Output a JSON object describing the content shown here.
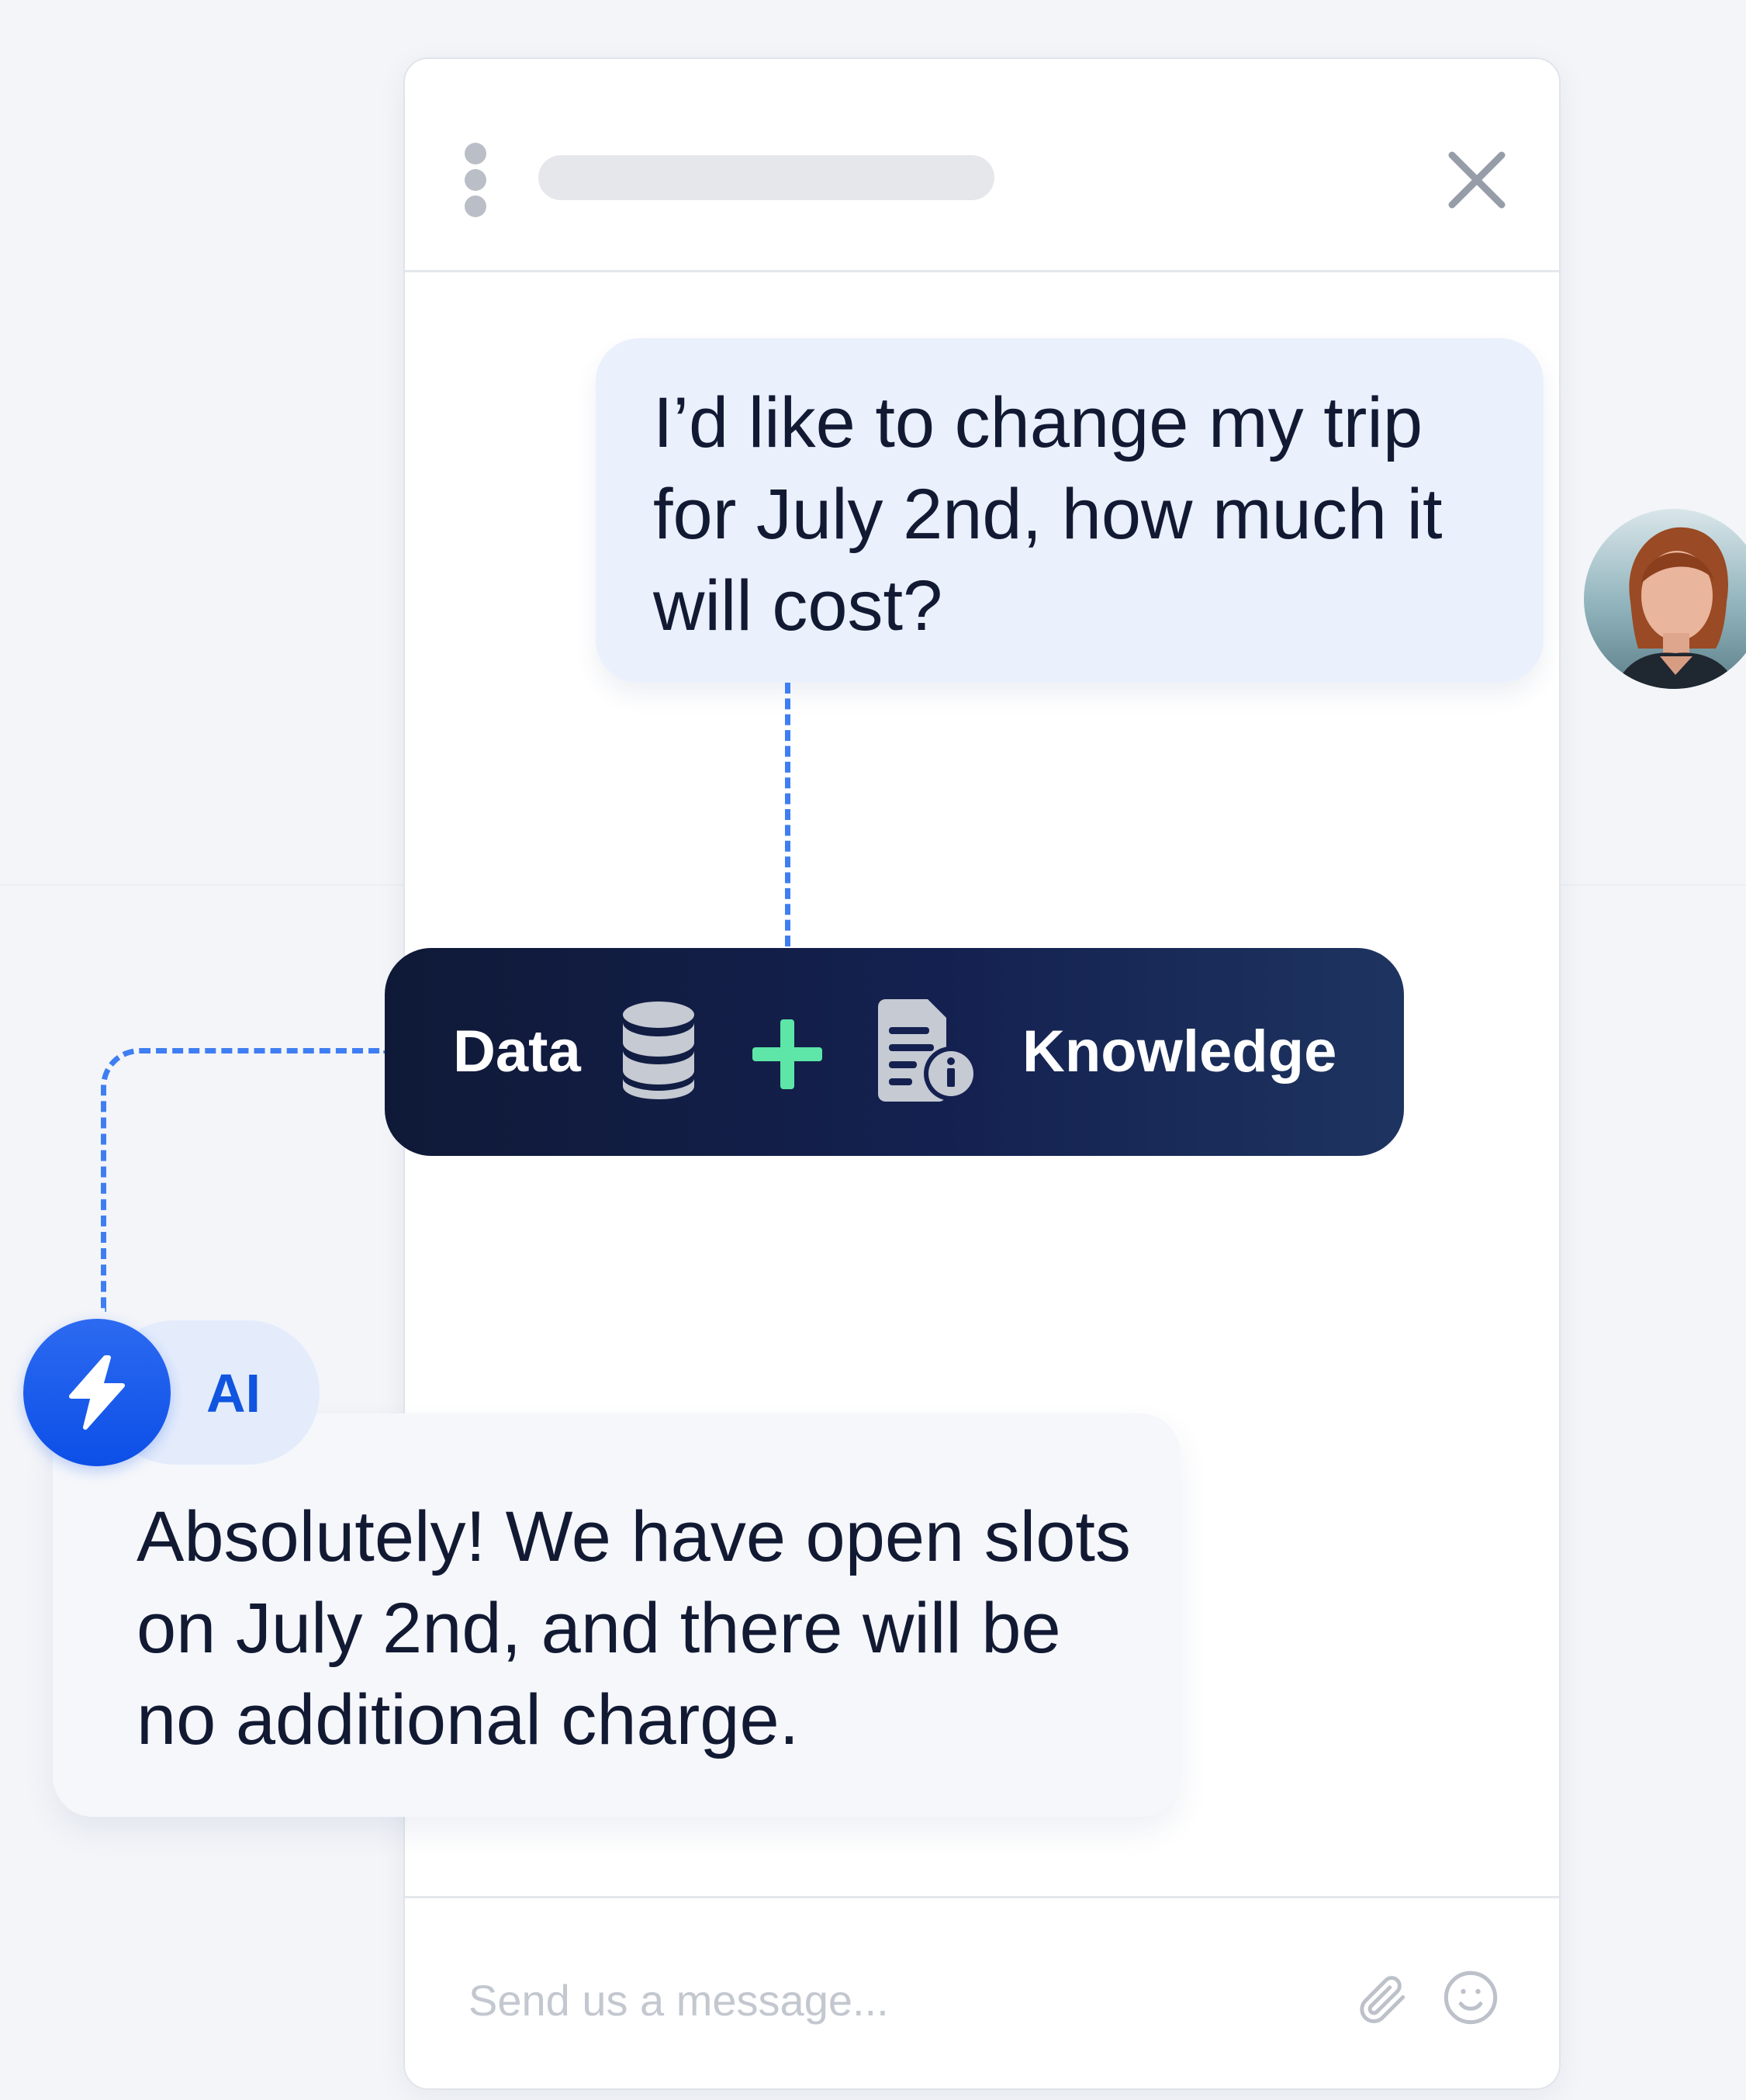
{
  "widget": {
    "input": {
      "placeholder": "Send us a message..."
    }
  },
  "messages": {
    "user": "I’d like to change my trip for July 2nd, how much it will cost?",
    "ai": "Absolutely! We have open slots on July 2nd, and there will be no additional charge."
  },
  "knowledge_bar": {
    "left_label": "Data",
    "right_label": "Knowledge"
  },
  "ai_badge": {
    "label": "AI"
  },
  "icons": {
    "header_menu": "kebab-menu-icon",
    "header_close": "close-icon",
    "database": "database-icon",
    "plus": "plus-icon",
    "document": "document-info-icon",
    "ai": "lightning-icon",
    "attach": "paperclip-icon",
    "emoji": "smiley-icon"
  },
  "colors": {
    "accent_blue": "#0c4fe8",
    "connector_dash": "#3f7ef2",
    "plus_green": "#5de6a8",
    "bar_dark": "#0f1937",
    "user_bubble": "#eaf0fc",
    "ai_bubble": "#f5f7fb"
  }
}
